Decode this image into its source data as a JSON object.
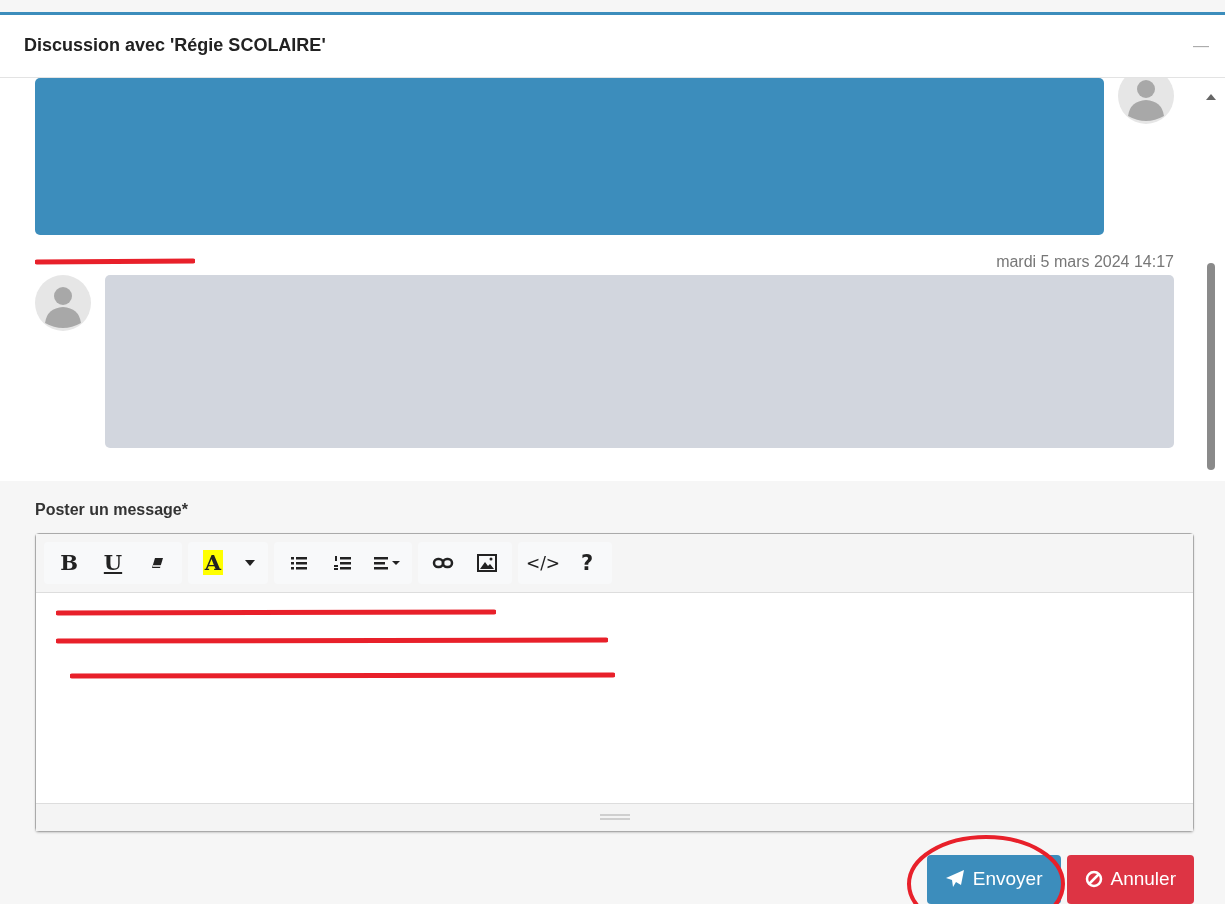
{
  "window": {
    "title": "Discussion avec 'Régie SCOLAIRE'",
    "minimize": "—"
  },
  "messages": [
    {
      "kind": "own"
    },
    {
      "kind": "other",
      "date": "mardi 5 mars 2024 14:17"
    }
  ],
  "compose": {
    "label": "Poster un message*",
    "toolbar": [
      [
        {
          "kind": "bold",
          "label": "B"
        },
        {
          "kind": "underline",
          "label": "U"
        },
        {
          "kind": "eraser"
        }
      ],
      [
        {
          "kind": "highlight",
          "label": "A"
        },
        {
          "kind": "caret"
        }
      ],
      [
        {
          "kind": "bullets"
        },
        {
          "kind": "numbers"
        },
        {
          "kind": "align"
        }
      ],
      [
        {
          "kind": "link"
        },
        {
          "kind": "image"
        }
      ],
      [
        {
          "kind": "code",
          "label": "</>"
        },
        {
          "kind": "help",
          "label": "?"
        }
      ]
    ]
  },
  "buttons": [
    {
      "kind": "send",
      "label": "Envoyer"
    },
    {
      "kind": "cancel",
      "label": "Annuler"
    }
  ]
}
